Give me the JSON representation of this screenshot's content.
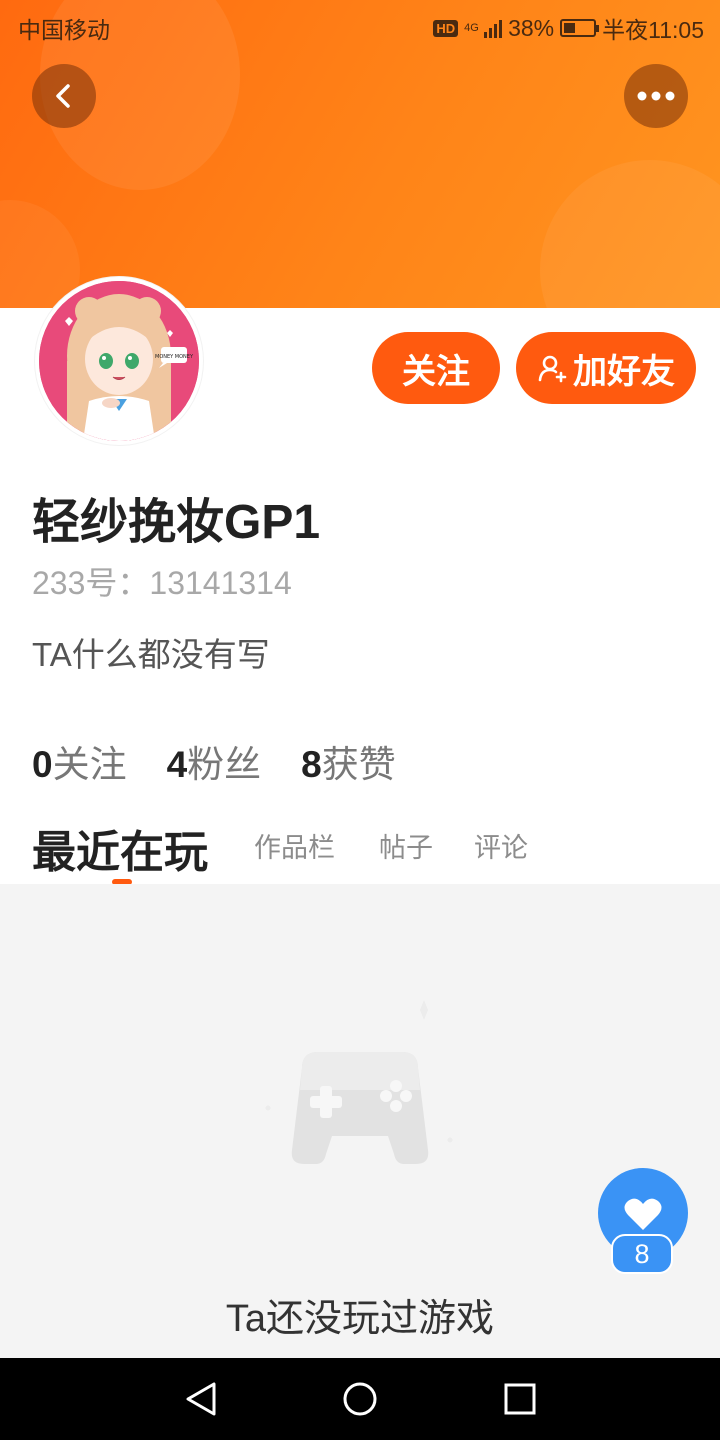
{
  "status_bar": {
    "carrier": "中国移动",
    "hd": "HD",
    "network": "4G",
    "battery": "38%",
    "time": "半夜11:05"
  },
  "header": {
    "back_icon": "chevron-left-icon",
    "more_icon": "ellipsis-icon",
    "accent_color": "#ff7a14"
  },
  "profile": {
    "follow_label": "关注",
    "add_friend_label": "加好友",
    "username": "轻纱挽妆GP1",
    "user_id": "233号：13141314",
    "bio": "TA什么都没有写",
    "avatar_badge": "MONEY MONEY"
  },
  "stats": [
    {
      "value": "0",
      "label": "关注"
    },
    {
      "value": "4",
      "label": "粉丝"
    },
    {
      "value": "8",
      "label": "获赞"
    }
  ],
  "tabs": {
    "active": "最近在玩",
    "works": "作品栏",
    "posts": "帖子",
    "comments": "评论"
  },
  "empty_state": {
    "icon": "gamepad-icon",
    "text": "Ta还没玩过游戏"
  },
  "like_fab": {
    "icon": "heart-icon",
    "count": "8",
    "color": "#3a93f5"
  },
  "nav": {
    "back_icon": "triangle-back-icon",
    "home_icon": "circle-home-icon",
    "recents_icon": "square-recents-icon"
  }
}
